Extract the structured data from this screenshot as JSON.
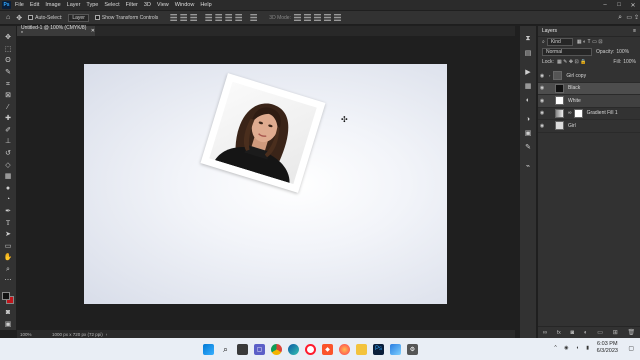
{
  "menubar": {
    "app_logo": "Ps",
    "items": [
      "File",
      "Edit",
      "Image",
      "Layer",
      "Type",
      "Select",
      "Filter",
      "3D",
      "View",
      "Window",
      "Help"
    ]
  },
  "options_bar": {
    "auto_select": "Auto-Select:",
    "auto_select_target": "Layer",
    "show_transform": "Show Transform Controls",
    "mode_3d": "3D Mode:"
  },
  "document": {
    "tab_title": "Untitled-1 @ 100% (CMYK/8) *"
  },
  "status_bar": {
    "zoom": "100%",
    "doc_info": "1000 px x 720 px (72 ppi)"
  },
  "layers_panel": {
    "title": "Layers",
    "filter_kind": "Kind",
    "blend_mode": "Normal",
    "opacity_label": "Opacity:",
    "opacity_value": "100%",
    "lock_label": "Lock:",
    "fill_label": "Fill:",
    "fill_value": "100%",
    "layers": [
      {
        "name": "Girl copy"
      },
      {
        "name": "Black"
      },
      {
        "name": "White"
      },
      {
        "name": "Gradient Fill 1"
      },
      {
        "name": "Girl"
      }
    ]
  },
  "taskbar": {
    "time": "6:03 PM",
    "date": "6/3/2023"
  },
  "colors": {
    "foreground": "#111111",
    "background": "#c0161c",
    "ps_blue": "#31a8ff"
  }
}
